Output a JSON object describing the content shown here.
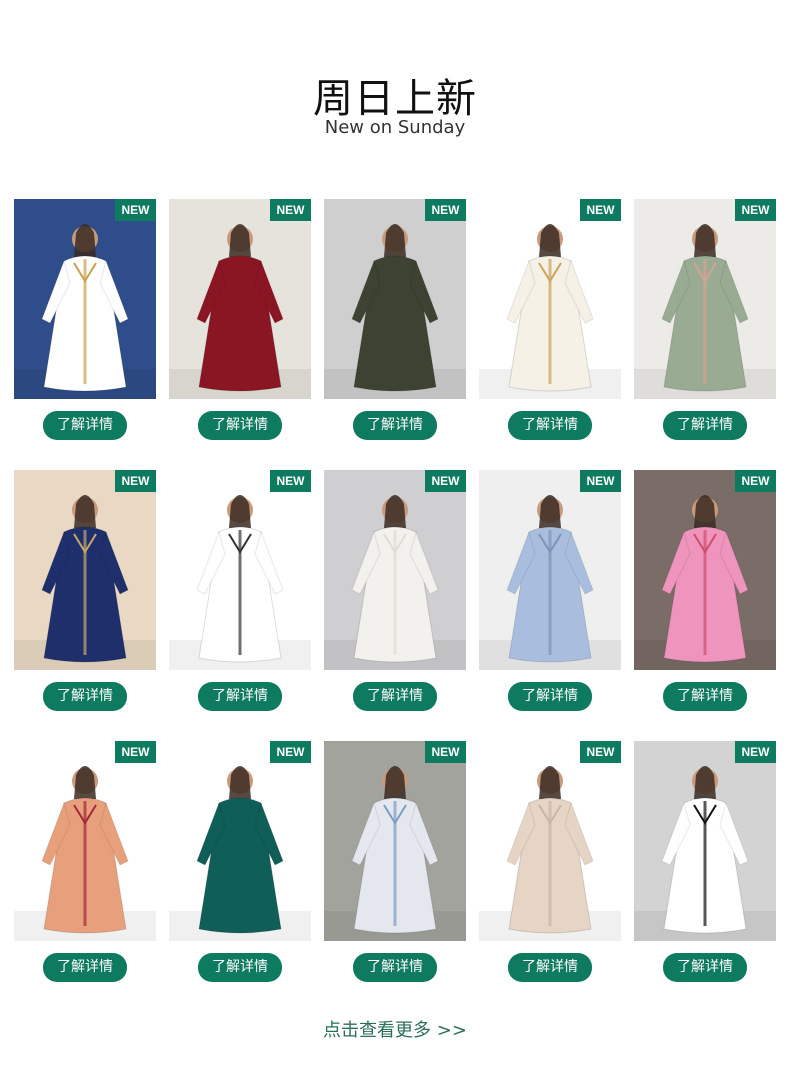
{
  "header": {
    "title": "周日上新",
    "subtitle": "New on Sunday"
  },
  "badge_text": "NEW",
  "button_label": "了解详情",
  "more_link": "点击查看更多 >>",
  "products": [
    {
      "dress": "#ffffff",
      "bg": "#2f4d8a",
      "accent": "#c8a050"
    },
    {
      "dress": "#8a1624",
      "bg": "#e6e3dc",
      "accent": "#8a1624"
    },
    {
      "dress": "#3d4233",
      "bg": "#cfcfcf",
      "accent": "#3d4233"
    },
    {
      "dress": "#f6f1e6",
      "bg": "#ffffff",
      "accent": "#c9a45a"
    },
    {
      "dress": "#9aab93",
      "bg": "#ecebe8",
      "accent": "#d7a392"
    },
    {
      "dress": "#1f2f6b",
      "bg": "#e9d9c4",
      "accent": "#c9a86a"
    },
    {
      "dress": "#ffffff",
      "bg": "#ffffff",
      "accent": "#333333"
    },
    {
      "dress": "#f3f1ed",
      "bg": "#cfcfd2",
      "accent": "#e0ddd6"
    },
    {
      "dress": "#a9bede",
      "bg": "#efefef",
      "accent": "#7f93b8"
    },
    {
      "dress": "#ee94bd",
      "bg": "#7a6c66",
      "accent": "#d24d6b"
    },
    {
      "dress": "#e8a07c",
      "bg": "#ffffff",
      "accent": "#a2283a"
    },
    {
      "dress": "#0f5e57",
      "bg": "#ffffff",
      "accent": "#0f5e57"
    },
    {
      "dress": "#e4e8ee",
      "bg": "#a3a39e",
      "accent": "#7e9cc2"
    },
    {
      "dress": "#e6d4c5",
      "bg": "#ffffff",
      "accent": "#c9b6a6"
    },
    {
      "dress": "#ffffff",
      "bg": "#d3d3d3",
      "accent": "#111111"
    }
  ]
}
